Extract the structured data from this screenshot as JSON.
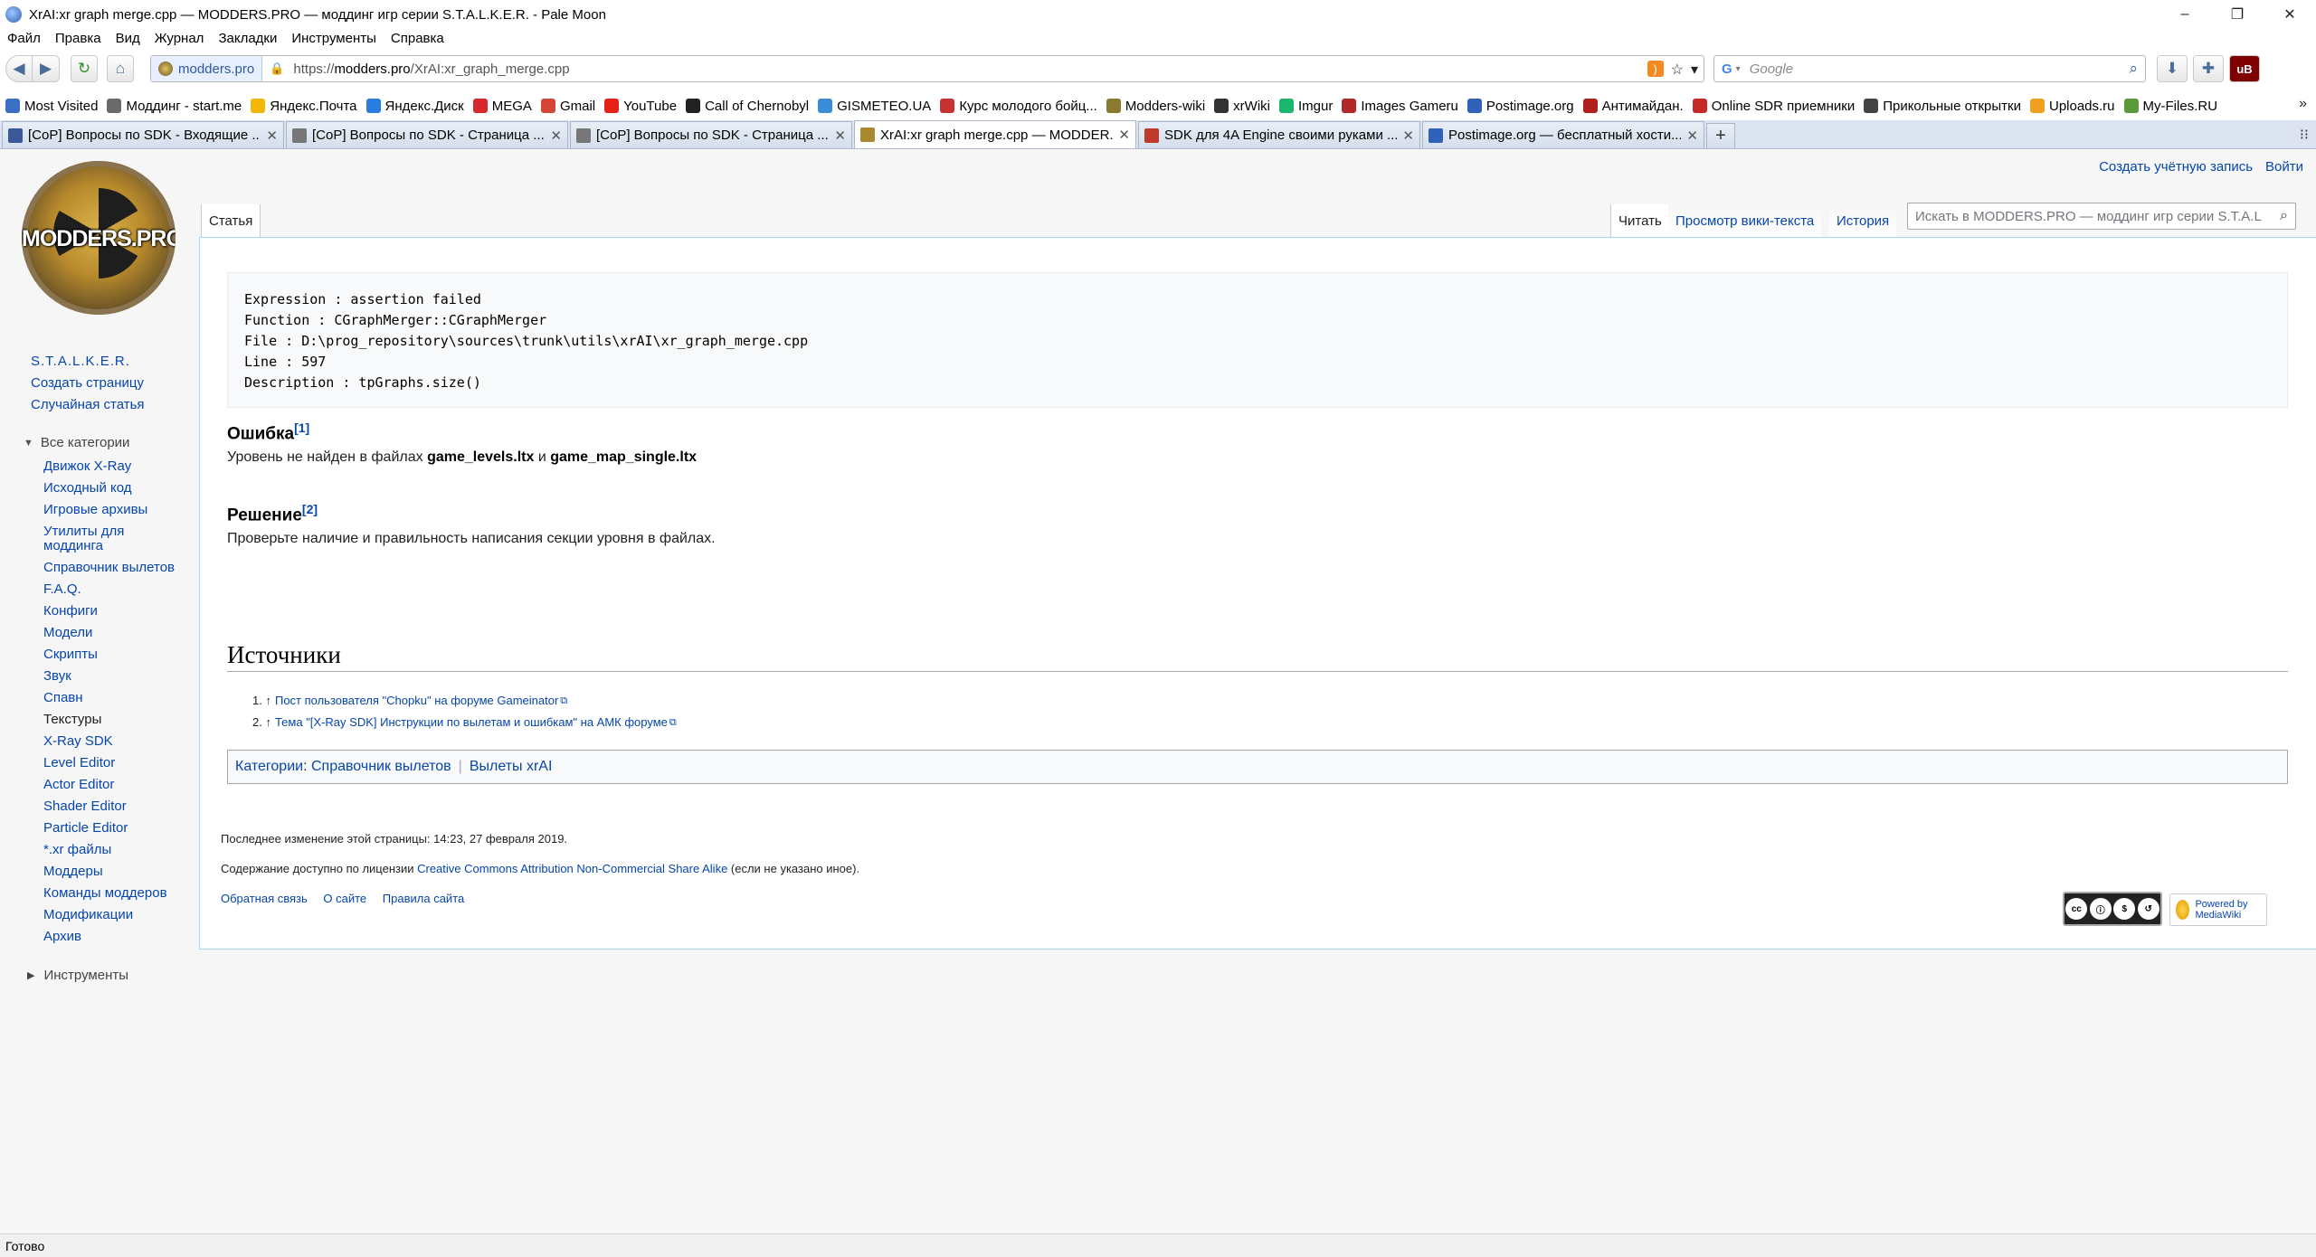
{
  "window": {
    "title": "XrAI:xr graph merge.cpp — MODDERS.PRO — моддинг игр серии S.T.A.L.K.E.R. - Pale Moon",
    "minimize": "–",
    "maximize": "❐",
    "close": "✕"
  },
  "menu": [
    "Файл",
    "Правка",
    "Вид",
    "Журнал",
    "Закладки",
    "Инструменты",
    "Справка"
  ],
  "navbar": {
    "identity": "modders.pro",
    "url_prefix": "https://",
    "url_host": "modders.pro",
    "url_path": "/XrAI:xr_graph_merge.cpp",
    "search_engine": "G",
    "search_placeholder": "Google"
  },
  "bookmarks": [
    {
      "label": "Most Visited",
      "color": "#3a6fc4"
    },
    {
      "label": "Моддинг - start.me",
      "color": "#6a6a6a"
    },
    {
      "label": "Яндекс.Почта",
      "color": "#f2b705"
    },
    {
      "label": "Яндекс.Диск",
      "color": "#2a7de1"
    },
    {
      "label": "MEGA",
      "color": "#d9272e"
    },
    {
      "label": "Gmail",
      "color": "#d44638"
    },
    {
      "label": "YouTube",
      "color": "#e62117"
    },
    {
      "label": "Call of Chernobyl",
      "color": "#222222"
    },
    {
      "label": "GISMETEO.UA",
      "color": "#3c8dd6"
    },
    {
      "label": "Курс молодого бойц...",
      "color": "#c83232"
    },
    {
      "label": "Modders-wiki",
      "color": "#8a7a30"
    },
    {
      "label": "xrWiki",
      "color": "#333333"
    },
    {
      "label": "Imgur",
      "color": "#1bb76e"
    },
    {
      "label": "Images Gameru",
      "color": "#b02a2a"
    },
    {
      "label": "Postimage.org",
      "color": "#2f62b8"
    },
    {
      "label": "Антимайдан.",
      "color": "#b01e1e"
    },
    {
      "label": "Online SDR приемники",
      "color": "#c62828"
    },
    {
      "label": "Прикольные открытки",
      "color": "#444444"
    },
    {
      "label": "Uploads.ru",
      "color": "#f0a020"
    },
    {
      "label": "My-Files.RU",
      "color": "#5a9a3a"
    }
  ],
  "tabs": [
    {
      "label": "[CoP] Вопросы по SDK - Входящие ...",
      "color": "#3b5998",
      "active": false
    },
    {
      "label": "[CoP] Вопросы по SDK - Страница ...",
      "color": "#777777",
      "active": false
    },
    {
      "label": "[CoP] Вопросы по SDK - Страница ...",
      "color": "#777777",
      "active": false
    },
    {
      "label": "XrAI:xr graph merge.cpp — MODDER...",
      "color": "#a8892e",
      "active": true
    },
    {
      "label": "SDK для 4A Engine своими руками ...",
      "color": "#c0392b",
      "active": false
    },
    {
      "label": "Postimage.org — бесплатный хости...",
      "color": "#2f62b8",
      "active": false
    }
  ],
  "wiki": {
    "logo_text": "MODDERS.PRO",
    "personal": [
      "Создать учётную запись",
      "Войти"
    ],
    "page_tabs": {
      "article": "Статья",
      "read": "Читать",
      "view_source": "Просмотр вики-текста",
      "history": "История"
    },
    "search_placeholder": "Искать в MODDERS.PRO — моддинг игр серии S.T.A.L",
    "sidebar": {
      "top_links": [
        "S.T.A.L.K.E.R.",
        "Создать страницу",
        "Случайная статья"
      ],
      "categories_label": "Все категории",
      "categories": [
        "Движок X-Ray",
        "Исходный код",
        "Игровые архивы",
        "Утилиты для моддинга",
        "Справочник вылетов",
        "F.A.Q.",
        "Конфиги",
        "Модели",
        "Скрипты",
        "Звук",
        "Спавн",
        "Текстуры",
        "X-Ray SDK",
        "Level Editor",
        "Actor Editor",
        "Shader Editor",
        "Particle Editor",
        "*.xr файлы",
        "Моддеры",
        "Команды моддеров",
        "Модификации",
        "Архив"
      ],
      "tools_label": "Инструменты"
    },
    "code": "Expression : assertion failed\nFunction : CGraphMerger::CGraphMerger\nFile : D:\\prog_repository\\sources\\trunk\\utils\\xrAI\\xr_graph_merge.cpp\nLine : 597\nDescription : tpGraphs.size()",
    "error_heading": "Ошибка",
    "error_ref": "[1]",
    "error_text_pre": "Уровень не найден в файлах ",
    "error_file1": "game_levels.ltx",
    "error_and": " и ",
    "error_file2": "game_map_single.ltx",
    "solution_heading": "Решение",
    "solution_ref": "[2]",
    "solution_text": "Проверьте наличие и правильность написания секции уровня в файлах.",
    "sources_heading": "Источники",
    "refs": [
      {
        "num": "1. ↑",
        "text": "Пост пользователя \"Chopku\" на форуме Gameinator"
      },
      {
        "num": "2. ↑",
        "text": "Тема \"[X-Ray SDK] Инструкции по вылетам и ошибкам\" на АМК форуме"
      }
    ],
    "catlinks_label": "Категории",
    "catlinks": [
      "Справочник вылетов",
      "Вылеты xrAI"
    ],
    "footer": {
      "last_modified": "Последнее изменение этой страницы: 14:23, 27 февраля 2019.",
      "license_pre": "Содержание доступно по лицензии ",
      "license_link": "Creative Commons Attribution Non-Commercial Share Alike",
      "license_post": " (если не указано иное).",
      "links": [
        "Обратная связь",
        "О сайте",
        "Правила сайта"
      ],
      "cc_badge": "cc",
      "mw_badge": "Powered by MediaWiki"
    }
  },
  "status": "Готово"
}
